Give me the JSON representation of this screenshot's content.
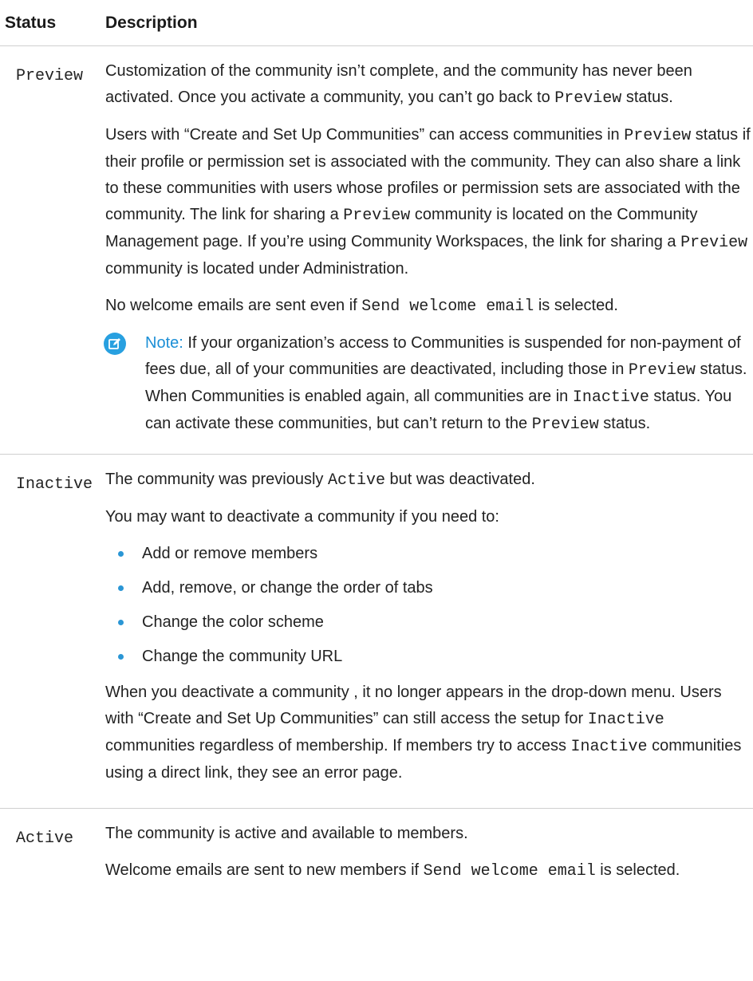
{
  "headers": {
    "status": "Status",
    "description": "Description"
  },
  "rows": [
    {
      "status": "Preview",
      "p1": {
        "a": "Customization of the community isn’t complete, and the community has never been activated. Once you activate a community, you can’t go back to ",
        "code": "Preview",
        "b": " status."
      },
      "p2": {
        "a": "Users with “Create and Set Up Communities” can access communities in ",
        "code1": "Preview",
        "b": " status if their profile or permission set is associated with the community. They can also share a link to these communities with users whose profiles or permission sets are associated with the community. The link for sharing a ",
        "code2": "Preview",
        "c": " community is located on the Community Management page. If you’re using Community Workspaces, the link for sharing a ",
        "code3": "Preview",
        "d": " community is located under Administration."
      },
      "p3": {
        "a": "No welcome emails are sent even if ",
        "code": "Send welcome email",
        "b": " is selected."
      },
      "note": {
        "label": "Note:",
        "a": " If your organization’s access to Communities is suspended for non-payment of fees due, all of your communities are deactivated, including those in ",
        "code1": "Preview",
        "b": " status. When Communities is enabled again, all communities are in ",
        "code2": "Inactive",
        "c": " status. You can activate these communities, but can’t return to the ",
        "code3": "Preview",
        "d": " status.",
        "icon": "edit-note-icon"
      }
    },
    {
      "status": "Inactive",
      "p1": {
        "a": "The community was previously ",
        "code": "Active",
        "b": " but was deactivated."
      },
      "p2": "You may want to deactivate a community if you need to:",
      "bullets": [
        "Add or remove members",
        "Add, remove, or change the order of tabs",
        "Change the color scheme",
        "Change the community URL"
      ],
      "p3": {
        "a": "When you deactivate a community , it no longer appears in the drop-down menu. Users with “Create and Set Up Communities” can still access the setup for ",
        "code1": "Inactive",
        "b": " communities regardless of membership. If members try to access ",
        "code2": "Inactive",
        "c": " communities using a direct link, they see an error page."
      }
    },
    {
      "status": "Active",
      "p1": "The community is active and available to members.",
      "p2": {
        "a": "Welcome emails are sent to new members if ",
        "code": "Send welcome email",
        "b": " is selected."
      }
    }
  ],
  "colors": {
    "accent": "#1c8fd6",
    "border": "#cfcfcf",
    "text": "#222222"
  }
}
